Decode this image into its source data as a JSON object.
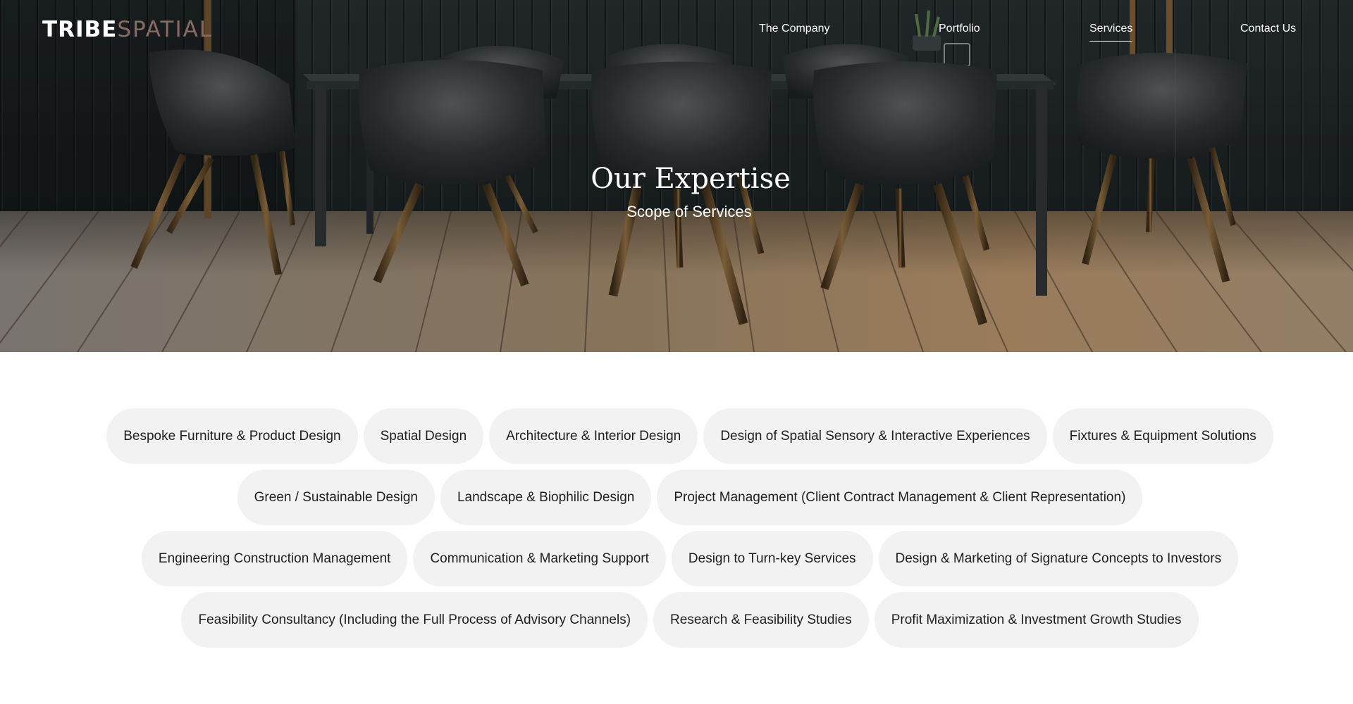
{
  "nav": {
    "logo_primary": "TRIBE",
    "logo_secondary": "SPATIAL",
    "links": [
      "The Company",
      "Portfolio",
      "Services",
      "Contact Us"
    ],
    "active": "Services"
  },
  "hero": {
    "title": "Our Expertise",
    "subtitle": "Scope of Services"
  },
  "services": {
    "rows": [
      [
        "Bespoke Furniture & Product Design",
        "Spatial Design",
        "Architecture & Interior Design",
        "Design of Spatial Sensory & Interactive Experiences",
        "Fixtures & Equipment Solutions"
      ],
      [
        "Green / Sustainable Design",
        "Landscape & Biophilic Design",
        "Project Management (Client Contract Management & Client Representation)"
      ],
      [
        "Engineering Construction Management",
        "Communication & Marketing Support",
        "Design to Turn-key Services",
        "Design & Marketing of Signature Concepts to Investors"
      ],
      [
        "Feasibility Consultancy (Including the Full Process of Advisory Channels)",
        "Research & Feasibility Studies",
        "Profit Maximization & Investment Growth Studies"
      ]
    ]
  },
  "colors": {
    "chip_bg": "#f2f2f2",
    "chip_text": "#1e1e1e",
    "logo_accent": "#8a6b62",
    "nav_text": "#ffffff"
  }
}
